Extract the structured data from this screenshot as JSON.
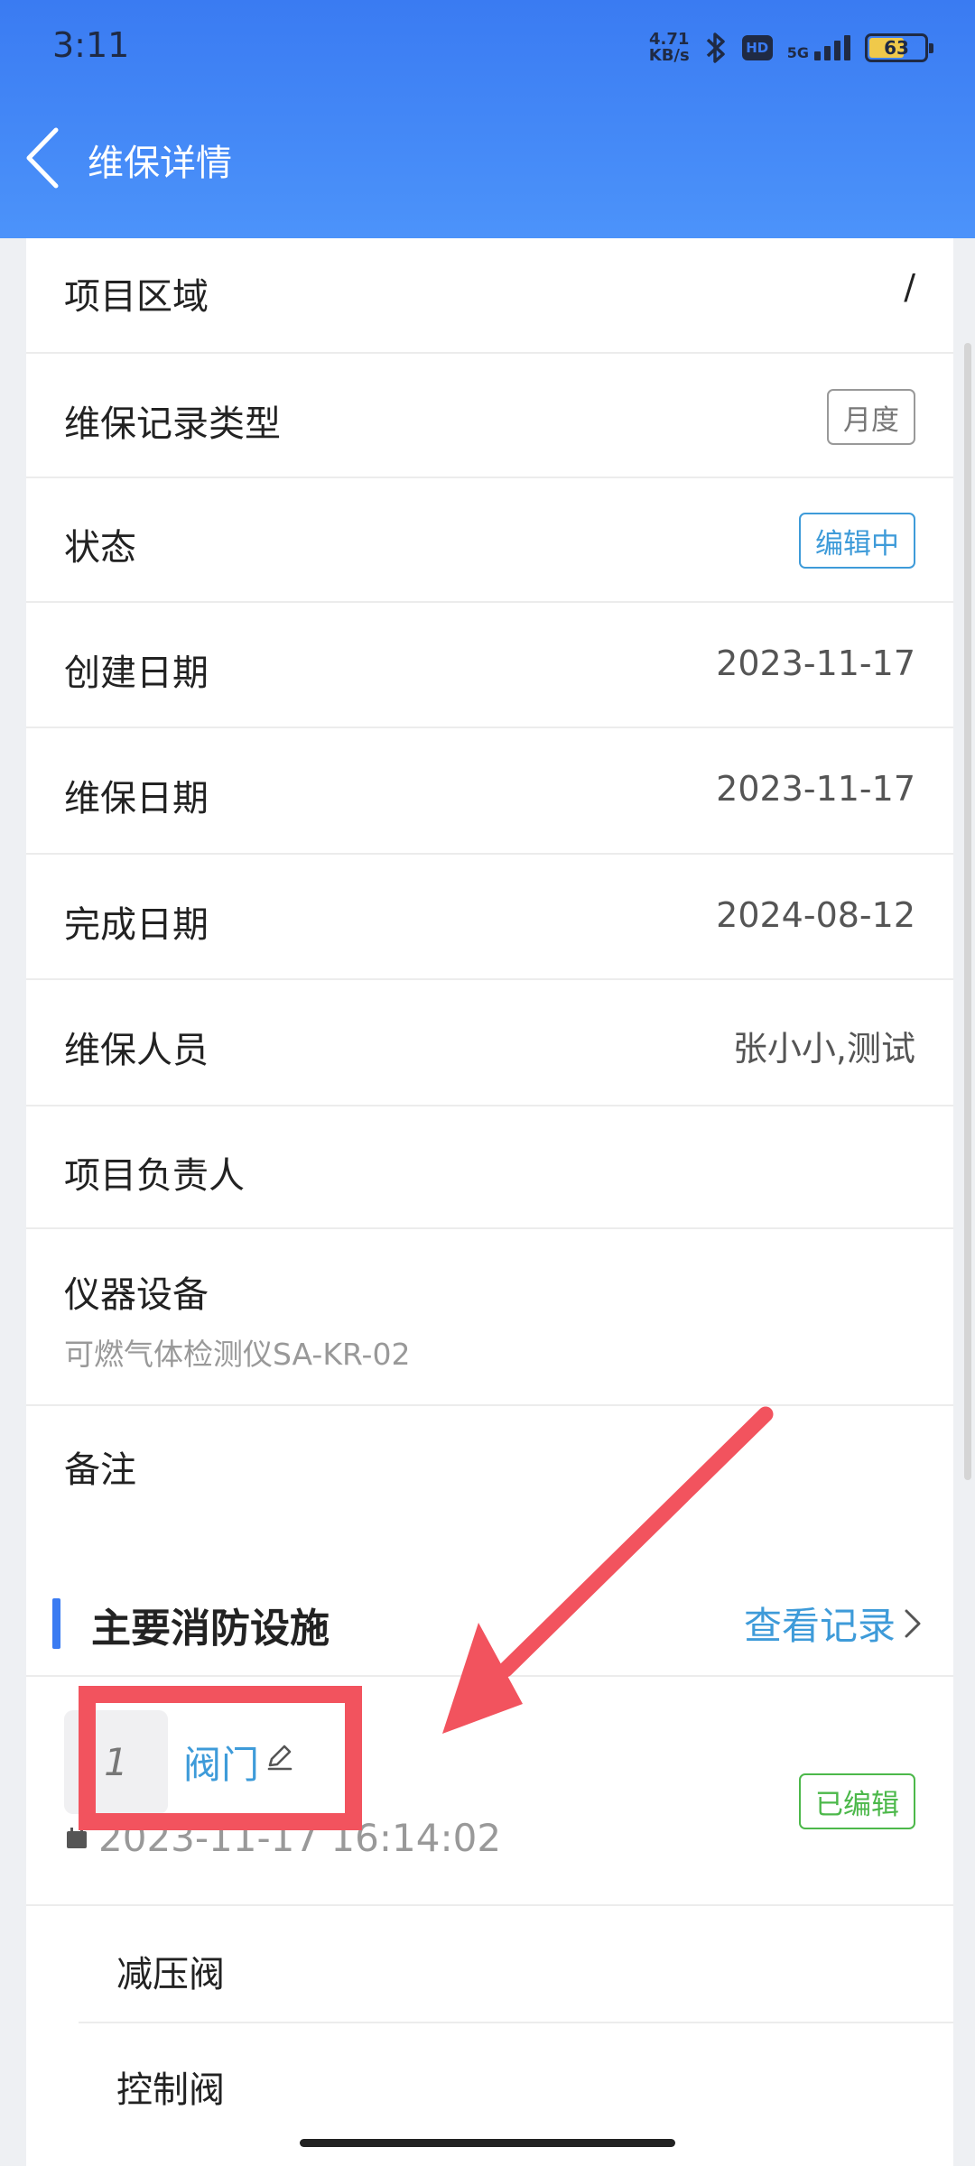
{
  "status_bar": {
    "time": "3:11",
    "net_speed_value": "4.71",
    "net_speed_unit": "KB/s",
    "hd_label": "HD",
    "signal_label": "5G",
    "battery": "63",
    "battery_level": 0.63
  },
  "nav": {
    "title": "维保详情"
  },
  "detail_rows": [
    {
      "label": "项目区域",
      "value": "/"
    },
    {
      "label": "维保记录类型",
      "tag": "月度"
    },
    {
      "label": "状态",
      "tag": "编辑中"
    },
    {
      "label": "创建日期",
      "value": "2023-11-17"
    },
    {
      "label": "维保日期",
      "value": "2023-11-17"
    },
    {
      "label": "完成日期",
      "value": "2024-08-12"
    },
    {
      "label": "维保人员",
      "value": "张小小,测试"
    },
    {
      "label": "项目负责人",
      "value": ""
    },
    {
      "label": "仪器设备",
      "sub_value": "可燃气体检测仪SA-KR-02"
    },
    {
      "label": "备注",
      "value": ""
    }
  ],
  "facilities": {
    "title": "主要消防设施",
    "view_record": "查看记录",
    "item": {
      "index": "1",
      "name": "阀门",
      "time": "2023-11-17 16:14:02",
      "status": "已编辑"
    },
    "sub_items": [
      "减压阀",
      "控制阀"
    ]
  },
  "colors": {
    "header": "#3a7bf2",
    "link": "#3e9bd9",
    "tag_green": "#4cb84a",
    "annotation": "#f2535e"
  }
}
